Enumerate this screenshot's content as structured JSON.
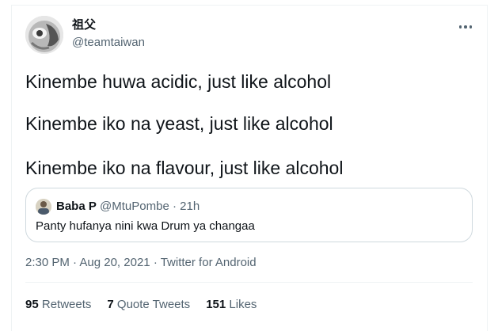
{
  "author": {
    "display_name": "祖父",
    "handle": "@teamtaiwan",
    "avatar_icon": "avatar-image"
  },
  "more_icon": "more-dots-icon",
  "tweet_lines": [
    "Kinembe huwa acidic, just like alcohol",
    "Kinembe iko na yeast, just like alcohol",
    "Kinembe iko na flavour, just like alcohol"
  ],
  "quoted": {
    "name": "Baba P",
    "handle": "@MtuPombe",
    "separator": "·",
    "age": "21h",
    "text": "Panty hufanya nini kwa Drum ya changaa"
  },
  "meta": {
    "time": "2:30 PM",
    "sep1": "·",
    "date": "Aug 20, 2021",
    "sep2": "·",
    "client": "Twitter for Android"
  },
  "stats": {
    "retweets_count": "95",
    "retweets_label": "Retweets",
    "quotes_count": "7",
    "quotes_label": "Quote Tweets",
    "likes_count": "151",
    "likes_label": "Likes"
  },
  "colors": {
    "text": "#0f1419",
    "secondary": "#536471",
    "border": "#cfd9de",
    "divider": "#eff3f4"
  }
}
